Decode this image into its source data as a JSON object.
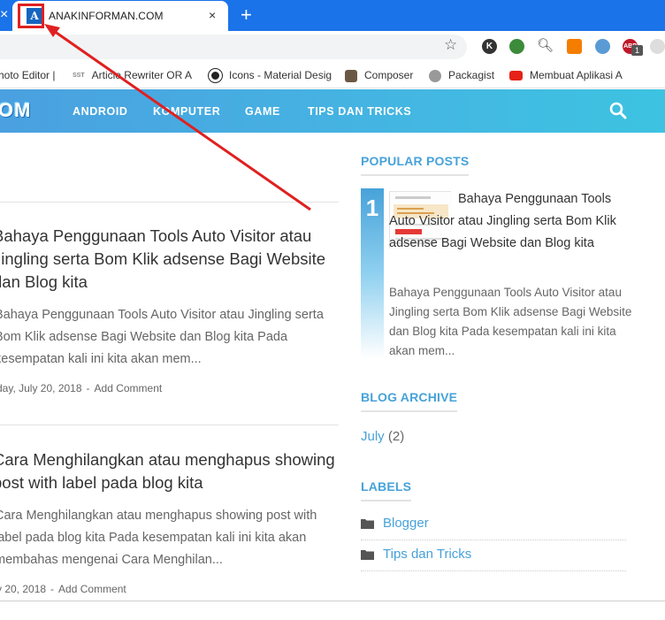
{
  "browser": {
    "tab_close_left": "×",
    "tab": {
      "title": "ANAKINFORMAN.COM",
      "close": "×",
      "favicon_letter": "A"
    },
    "new_tab": "+",
    "star": "☆",
    "extensions": {
      "k": "K",
      "abp": "ABP",
      "badge": "1"
    },
    "bookmarks": [
      {
        "label": "hoto Editor |"
      },
      {
        "label": "Article Rewriter OR A",
        "icon_text": "SST"
      },
      {
        "label": "Icons - Material Desig"
      },
      {
        "label": "Composer"
      },
      {
        "label": "Packagist"
      },
      {
        "label": "Membuat Aplikasi A"
      }
    ]
  },
  "site": {
    "logo": "OM",
    "nav": [
      "ANDROID",
      "KOMPUTER",
      "GAME",
      "TIPS DAN TRICKS"
    ]
  },
  "posts": [
    {
      "title": "Bahaya Penggunaan Tools Auto Visitor atau Jingling serta Bom Klik adsense Bagi Website dan Blog kita",
      "excerpt": "Bahaya Penggunaan Tools Auto Visitor atau Jingling serta Bom Klik adsense Bagi Website dan Blog kita Pada kesempatan kali ini kita akan mem...",
      "date": "day, July 20, 2018",
      "comment": "Add Comment"
    },
    {
      "title": "Cara Menghilangkan atau menghapus showing post with label pada blog kita",
      "excerpt": "Cara Menghilangkan atau menghapus showing post with label pada blog kita Pada kesempatan kali ini kita akan membahas mengenai Cara Menghilan...",
      "date": "y 20, 2018",
      "comment": "Add Comment"
    }
  ],
  "sidebar": {
    "popular_title": "POPULAR POSTS",
    "popular": {
      "rank": "1",
      "title": "Bahaya Penggunaan Tools Auto Visitor atau Jingling serta Bom Klik adsense Bagi Website dan Blog kita",
      "excerpt": "Bahaya Penggunaan Tools Auto Visitor atau Jingling serta Bom Klik adsense Bagi Website dan Blog kita Pada kesempatan kali ini kita akan mem..."
    },
    "archive_title": "BLOG ARCHIVE",
    "archive": {
      "month": "July",
      "count": "(2)"
    },
    "labels_title": "LABELS",
    "labels": [
      "Blogger",
      "Tips dan Tricks"
    ]
  },
  "colors": {
    "browser_blue": "#1a73e8",
    "accent": "#47a2d9",
    "annotation_red": "#e02020"
  }
}
